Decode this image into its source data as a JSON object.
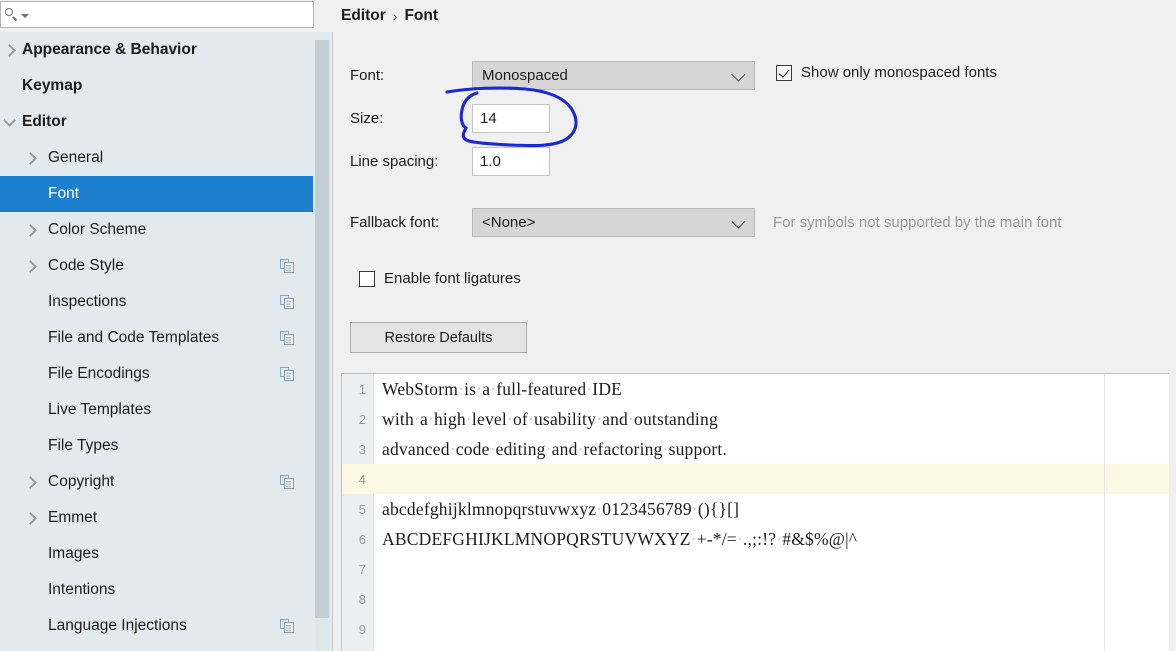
{
  "search": {
    "value": "",
    "placeholder": ""
  },
  "sidebar": {
    "items": [
      {
        "label": "Appearance & Behavior",
        "level": 0,
        "arrow": "right",
        "selected": false,
        "copy": false
      },
      {
        "label": "Keymap",
        "level": 0,
        "arrow": "none",
        "selected": false,
        "copy": false
      },
      {
        "label": "Editor",
        "level": 0,
        "arrow": "down",
        "selected": false,
        "copy": false
      },
      {
        "label": "General",
        "level": 1,
        "arrow": "right",
        "selected": false,
        "copy": false
      },
      {
        "label": "Font",
        "level": 1,
        "arrow": "none",
        "selected": true,
        "copy": false
      },
      {
        "label": "Color Scheme",
        "level": 1,
        "arrow": "right",
        "selected": false,
        "copy": false
      },
      {
        "label": "Code Style",
        "level": 1,
        "arrow": "right",
        "selected": false,
        "copy": true
      },
      {
        "label": "Inspections",
        "level": 1,
        "arrow": "none",
        "selected": false,
        "copy": true
      },
      {
        "label": "File and Code Templates",
        "level": 1,
        "arrow": "none",
        "selected": false,
        "copy": true
      },
      {
        "label": "File Encodings",
        "level": 1,
        "arrow": "none",
        "selected": false,
        "copy": true
      },
      {
        "label": "Live Templates",
        "level": 1,
        "arrow": "none",
        "selected": false,
        "copy": false
      },
      {
        "label": "File Types",
        "level": 1,
        "arrow": "none",
        "selected": false,
        "copy": false
      },
      {
        "label": "Copyright",
        "level": 1,
        "arrow": "right",
        "selected": false,
        "copy": true
      },
      {
        "label": "Emmet",
        "level": 1,
        "arrow": "right",
        "selected": false,
        "copy": false
      },
      {
        "label": "Images",
        "level": 1,
        "arrow": "none",
        "selected": false,
        "copy": false
      },
      {
        "label": "Intentions",
        "level": 1,
        "arrow": "none",
        "selected": false,
        "copy": false
      },
      {
        "label": "Language Injections",
        "level": 1,
        "arrow": "none",
        "selected": false,
        "copy": true
      }
    ]
  },
  "breadcrumb": {
    "parent": "Editor",
    "separator": "›",
    "current": "Font"
  },
  "settings": {
    "font_label": "Font:",
    "font_value": "Monospaced",
    "size_label": "Size:",
    "size_value": "14",
    "line_spacing_label": "Line spacing:",
    "line_spacing_value": "1.0",
    "show_only_monospaced_label": "Show only monospaced fonts",
    "show_only_monospaced_checked": true,
    "fallback_label": "Fallback font:",
    "fallback_value": "<None>",
    "fallback_hint": "For symbols not supported by the main font",
    "ligatures_label": "Enable font ligatures",
    "ligatures_checked": false,
    "restore_defaults_label": "Restore Defaults"
  },
  "preview": {
    "lines": [
      {
        "no": "1",
        "text": "WebStorm·is·a·full-featured·IDE",
        "caret": false
      },
      {
        "no": "2",
        "text": "with·a·high·level·of·usability·and·outstanding",
        "caret": false
      },
      {
        "no": "3",
        "text": "advanced·code·editing·and·refactoring·support.",
        "caret": false
      },
      {
        "no": "4",
        "text": "",
        "caret": true
      },
      {
        "no": "5",
        "text": "abcdefghijklmnopqrstuvwxyz·0123456789·(){}[]",
        "caret": false
      },
      {
        "no": "6",
        "text": "ABCDEFGHIJKLMNOPQRSTUVWXYZ·+-*/=·.,;:!?·#&$%@|^",
        "caret": false
      },
      {
        "no": "7",
        "text": "",
        "caret": false
      },
      {
        "no": "8",
        "text": "",
        "caret": false
      },
      {
        "no": "9",
        "text": "",
        "caret": false
      }
    ]
  },
  "annotation": {
    "shape": "hand-drawn-ellipse",
    "color": "#1a28d8",
    "target": "size-field"
  },
  "colors": {
    "selection_blue": "#1d7fd0",
    "sidebar_bg": "#e3eaef",
    "panel_bg": "#f0f0f0",
    "caret_line": "#fdf8e3",
    "annotation_blue": "#1a28d8"
  }
}
